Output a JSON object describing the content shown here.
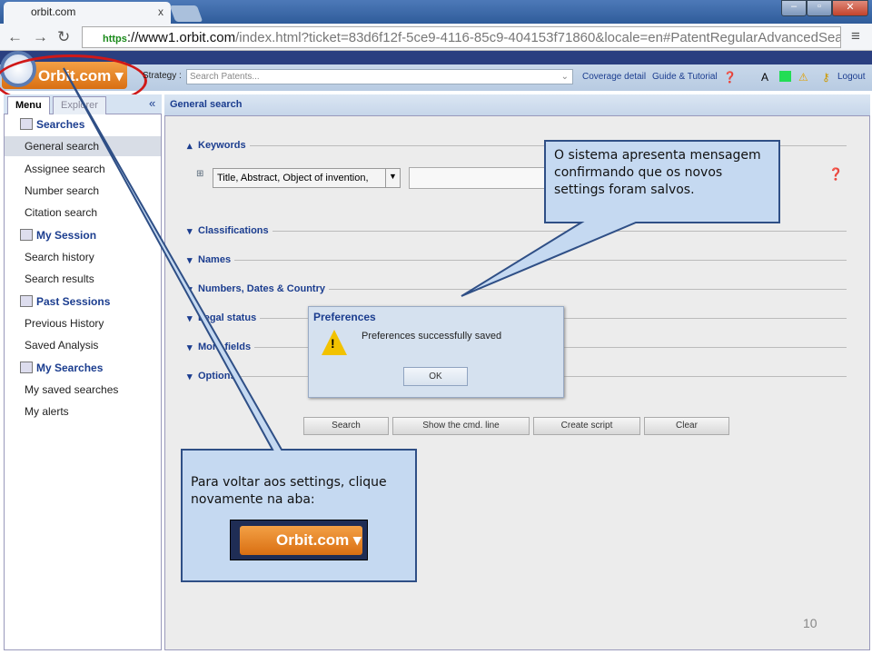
{
  "browser": {
    "tab_title": "orbit.com",
    "tab_close": "x",
    "url_scheme": "https",
    "url_host": "://www1.orbit.com",
    "url_rest": "/index.html?ticket=83d6f12f-5ce9-4116-85c9-404153f71860&locale=en#PatentRegularAdvancedSearch"
  },
  "app": {
    "logo": "Orbit.com ▾",
    "strategy_label": "Strategy :",
    "strategy_placeholder": "Search Patents...",
    "coverage": "Coverage detail",
    "guide": "Guide & Tutorial",
    "logout": "Logout"
  },
  "sidebar": {
    "tabs": [
      "Menu",
      "Explorer"
    ],
    "collapse": "«",
    "groups": [
      {
        "label": "Searches",
        "items": [
          "General search",
          "Assignee search",
          "Number search",
          "Citation search"
        ]
      },
      {
        "label": "My Session",
        "items": [
          "Search history",
          "Search results"
        ]
      },
      {
        "label": "Past Sessions",
        "items": [
          "Previous History",
          "Saved Analysis"
        ]
      },
      {
        "label": "My Searches",
        "items": [
          "My saved searches",
          "My alerts"
        ]
      }
    ],
    "selected": "General search"
  },
  "main": {
    "title": "General search",
    "sections": [
      "Keywords",
      "Classifications",
      "Names",
      "Numbers, Dates & Country",
      "Legal status",
      "More fields",
      "Options"
    ],
    "keyword_field": "Title, Abstract, Object of invention,",
    "buttons": [
      "Search",
      "Show the cmd. line",
      "Create script",
      "Clear"
    ]
  },
  "dialog": {
    "title": "Preferences",
    "message": "Preferences successfully saved",
    "ok": "OK"
  },
  "callouts": {
    "top": "O sistema apresenta mensagem confirmando que os novos settings foram salvos.",
    "bottom": "Para voltar aos settings, clique novamente na aba:",
    "mini_logo": "Orbit.com ▾"
  },
  "slide_number": "10"
}
